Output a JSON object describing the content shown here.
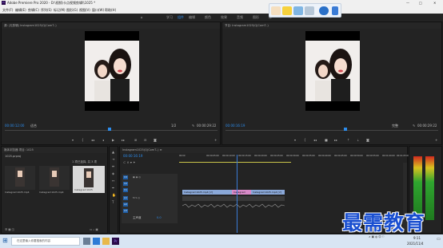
{
  "app": {
    "title": "Adobe Premiere Pro 2020 - D:\\视频\\卡点视频剪辑\\\\1025 *",
    "min": "—",
    "max": "□",
    "close": "✕"
  },
  "menu": [
    "文件(F)",
    "编辑(E)",
    "剪辑(C)",
    "序列(S)",
    "标记(M)",
    "图形(G)",
    "视图(V)",
    "窗口(W)",
    "帮助(H)"
  ],
  "workspaces": {
    "items": [
      "学习",
      "组件",
      "编辑",
      "颜色",
      "效果",
      "音频",
      "图形",
      "库"
    ],
    "active_index": 1
  },
  "source_monitor": {
    "header": "源: (无剪辑)  Instagram1025(Q(ComT..)",
    "timecode": "00:00:12:00",
    "fit": "适合",
    "duration": "00:00:29:22",
    "page": "1/2"
  },
  "program_monitor": {
    "header": "节目: Instagram1025(Q(ComT..)",
    "timecode": "00:00:16:19",
    "fit": "完整",
    "duration": "00:00:29:22",
    "page": "1/2"
  },
  "project_panel": {
    "header": "媒体浏览器   项目: 1025",
    "tab_active": "项目: 1025",
    "search": "1025.prproj",
    "selection_info": "1 项已选择, 共 3 项",
    "items": [
      {
        "name": "Instagram1025.mp4",
        "duration": "29:22"
      },
      {
        "name": "Instagram1025.mp4",
        "duration": "29:22"
      },
      {
        "name": "Instagram1025",
        "duration": "29:22"
      }
    ]
  },
  "timeline": {
    "header": "Instagram1025(Q(ComT..)  ≡",
    "timecode": "00:00:16:19",
    "ruler": [
      "00:00",
      "00:00:05:00",
      "00:00:10:00",
      "00:00:15:00",
      "00:00:20:00",
      "00:00:25:00",
      "00:00:30:00",
      "00:00:35:00",
      "00:00:40:00",
      "00:00:45:00",
      "00:00:50:00",
      "00:00:55:00",
      "00:01:00:00",
      "00:01:05:00"
    ],
    "tracks": [
      {
        "name": "V3"
      },
      {
        "name": "V2"
      },
      {
        "name": "V1"
      },
      {
        "name": "A1"
      },
      {
        "name": "A2"
      },
      {
        "name": "A3"
      }
    ],
    "master": "主声道",
    "master_value": "0.0",
    "clips": [
      {
        "label": "Instagram1025.mp4 [V]",
        "color": "#8aa8d8"
      },
      {
        "label": "Instagram",
        "color": "#d88ac8"
      },
      {
        "label": "Instagram1025.mp4 [V]",
        "color": "#8aa8d8"
      }
    ]
  },
  "float_toolbar": {
    "icons": [
      "hand-icon",
      "comment-icon",
      "share-icon",
      "search-icon",
      "info-icon",
      "arrow-icon"
    ]
  },
  "taskbar": {
    "search_placeholder": "在这里输入你要搜索的内容",
    "time": "9:11",
    "date": "2021/11/4"
  },
  "watermark": "最需教育",
  "colors": {
    "accent": "#2d8ceb",
    "playhead": "#3a7bd5"
  }
}
